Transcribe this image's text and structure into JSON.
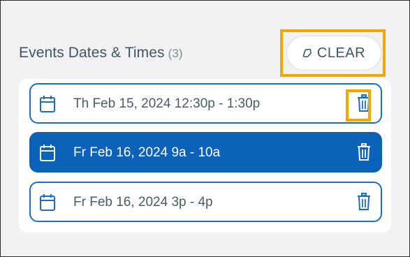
{
  "header": {
    "title": "Events Dates & Times",
    "count": "(3)"
  },
  "clear_button": {
    "label": "CLEAR",
    "icon": "eraser-icon"
  },
  "events": [
    {
      "label": "Th Feb 15, 2024 12:30p - 1:30p",
      "selected": false
    },
    {
      "label": "Fr Feb 16, 2024 9a - 10a",
      "selected": true
    },
    {
      "label": "Fr Feb 16, 2024 3p - 4p",
      "selected": false
    }
  ],
  "icons": {
    "date": "calendar-icon",
    "delete": "trash-icon"
  },
  "colors": {
    "accent_blue": "#0b62b8",
    "row_border": "#1a6fc1",
    "highlight_orange": "#f0a800",
    "text": "#3f5566"
  }
}
